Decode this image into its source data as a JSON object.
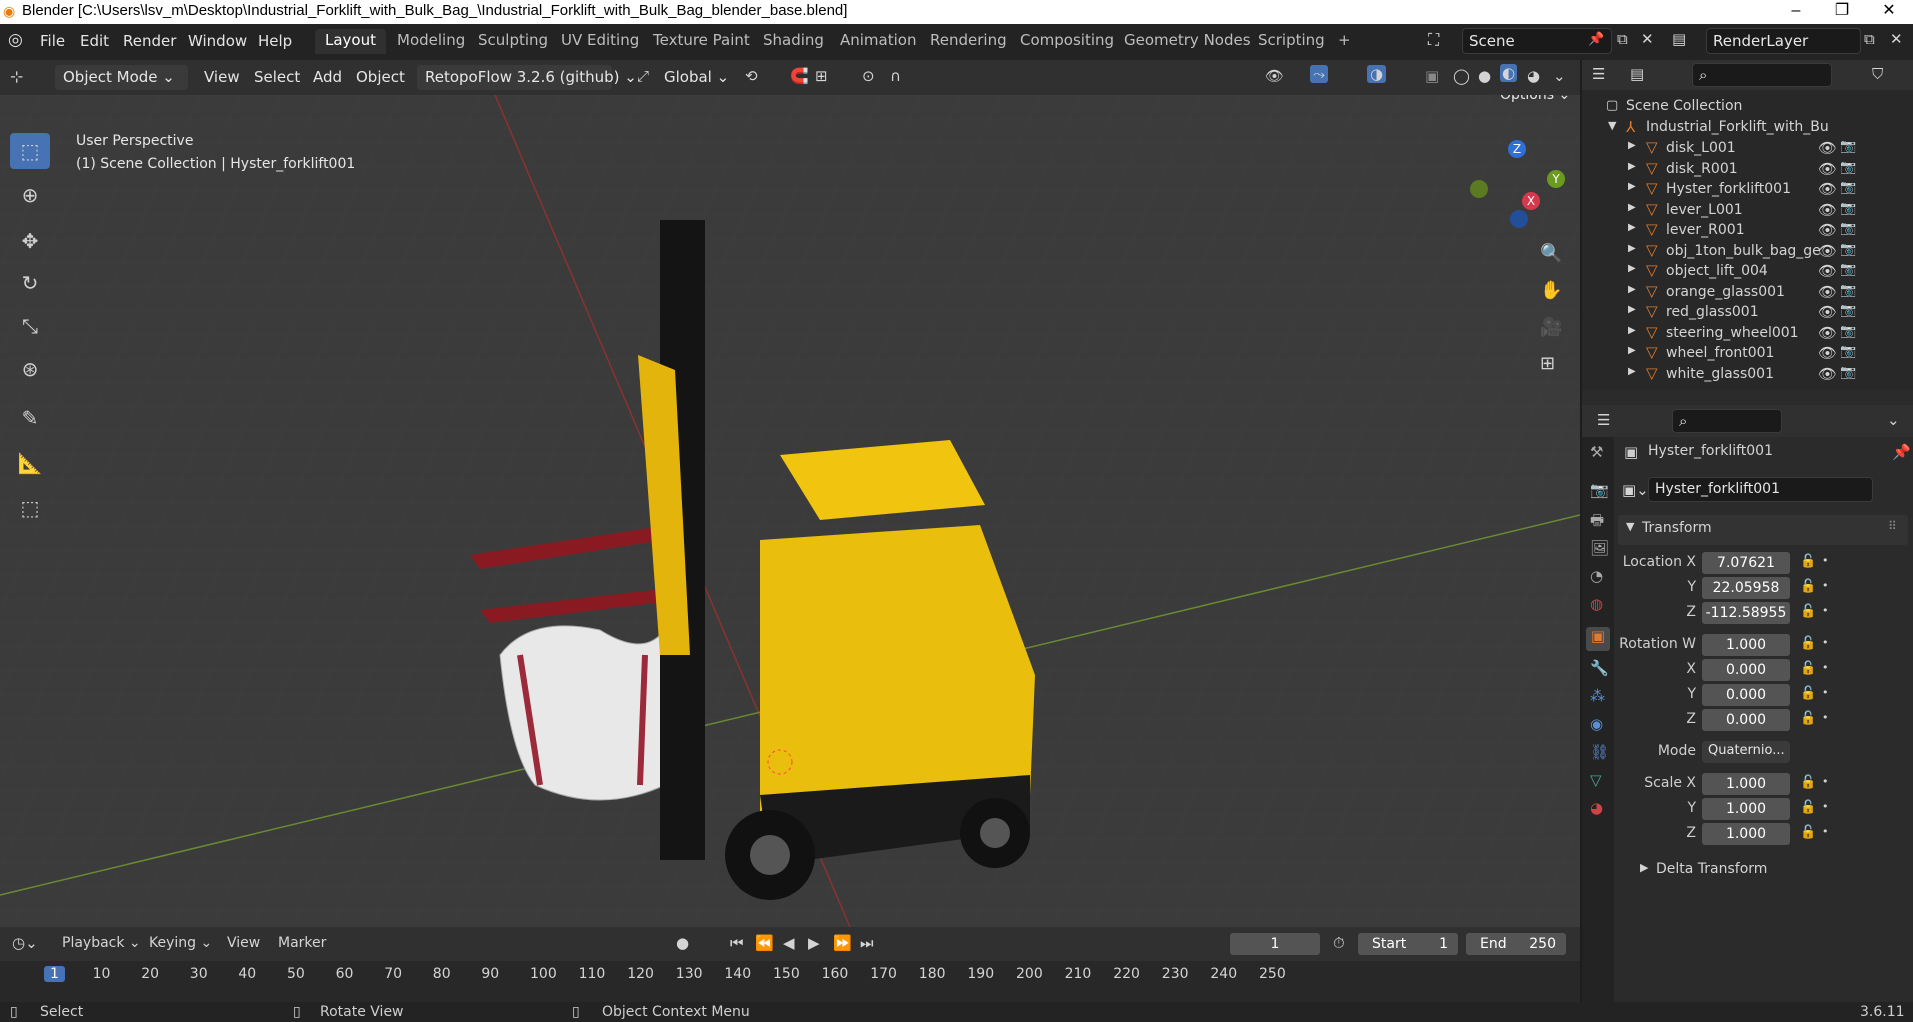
{
  "window": {
    "title": "Blender [C:\\Users\\lsv_m\\Desktop\\Industrial_Forklift_with_Bulk_Bag_\\Industrial_Forklift_with_Bulk_Bag_blender_base.blend]",
    "min": "–",
    "max": "❐",
    "close": "✕"
  },
  "menu": [
    "File",
    "Edit",
    "Render",
    "Window",
    "Help"
  ],
  "workspaces": [
    "Layout",
    "Modeling",
    "Sculpting",
    "UV Editing",
    "Texture Paint",
    "Shading",
    "Animation",
    "Rendering",
    "Compositing",
    "Geometry Nodes",
    "Scripting"
  ],
  "add_tab": "+",
  "scene": "Scene",
  "render_layer": "RenderLayer",
  "header": {
    "mode": "Object Mode",
    "view": "View",
    "select": "Select",
    "add": "Add",
    "object": "Object",
    "addon": "RetopoFlow 3.2.6 (github)",
    "orientation": "Global",
    "options": "Options"
  },
  "viewport": {
    "line1": "User Perspective",
    "line2": "(1) Scene Collection | Hyster_forklift001"
  },
  "gizmo": {
    "z": "Z",
    "y": "Y",
    "x": "X"
  },
  "outliner": {
    "root": "Scene Collection",
    "collection": "Industrial_Forklift_with_Bu",
    "items": [
      "disk_L001",
      "disk_R001",
      "Hyster_forklift001",
      "lever_L001",
      "lever_R001",
      "obj_1ton_bulk_bag_ge",
      "object_lift_004",
      "orange_glass001",
      "red_glass001",
      "steering_wheel001",
      "wheel_front001",
      "white_glass001"
    ]
  },
  "properties": {
    "object_name": "Hyster_forklift001",
    "data_name": "Hyster_forklift001",
    "transform": "Transform",
    "location_label": "Location X",
    "loc": [
      "7.07621",
      "22.05958",
      "-112.58955"
    ],
    "rotation_label": "Rotation W",
    "rot": [
      "1.000",
      "0.000",
      "0.000",
      "0.000"
    ],
    "mode_label": "Mode",
    "mode": "Quaternio...",
    "scale_label": "Scale X",
    "scale": [
      "1.000",
      "1.000",
      "1.000"
    ],
    "y": "Y",
    "z": "Z",
    "x": "X",
    "delta": "Delta Transform"
  },
  "timeline": {
    "playback": "Playback",
    "keying": "Keying",
    "view": "View",
    "marker": "Marker",
    "frame": "1",
    "start_label": "Start",
    "start": "1",
    "end_label": "End",
    "end": "250",
    "ticks": [
      "1",
      "10",
      "20",
      "30",
      "40",
      "50",
      "60",
      "70",
      "80",
      "90",
      "100",
      "110",
      "120",
      "130",
      "140",
      "150",
      "160",
      "170",
      "180",
      "190",
      "200",
      "210",
      "220",
      "230",
      "240",
      "250"
    ]
  },
  "status": {
    "select": "Select",
    "rotate": "Rotate View",
    "context": "Object Context Menu",
    "version": "3.6.11"
  },
  "colors": {
    "accent": "#4772b3",
    "object_orange": "#e07a2e",
    "selection": "#ff8a00"
  }
}
